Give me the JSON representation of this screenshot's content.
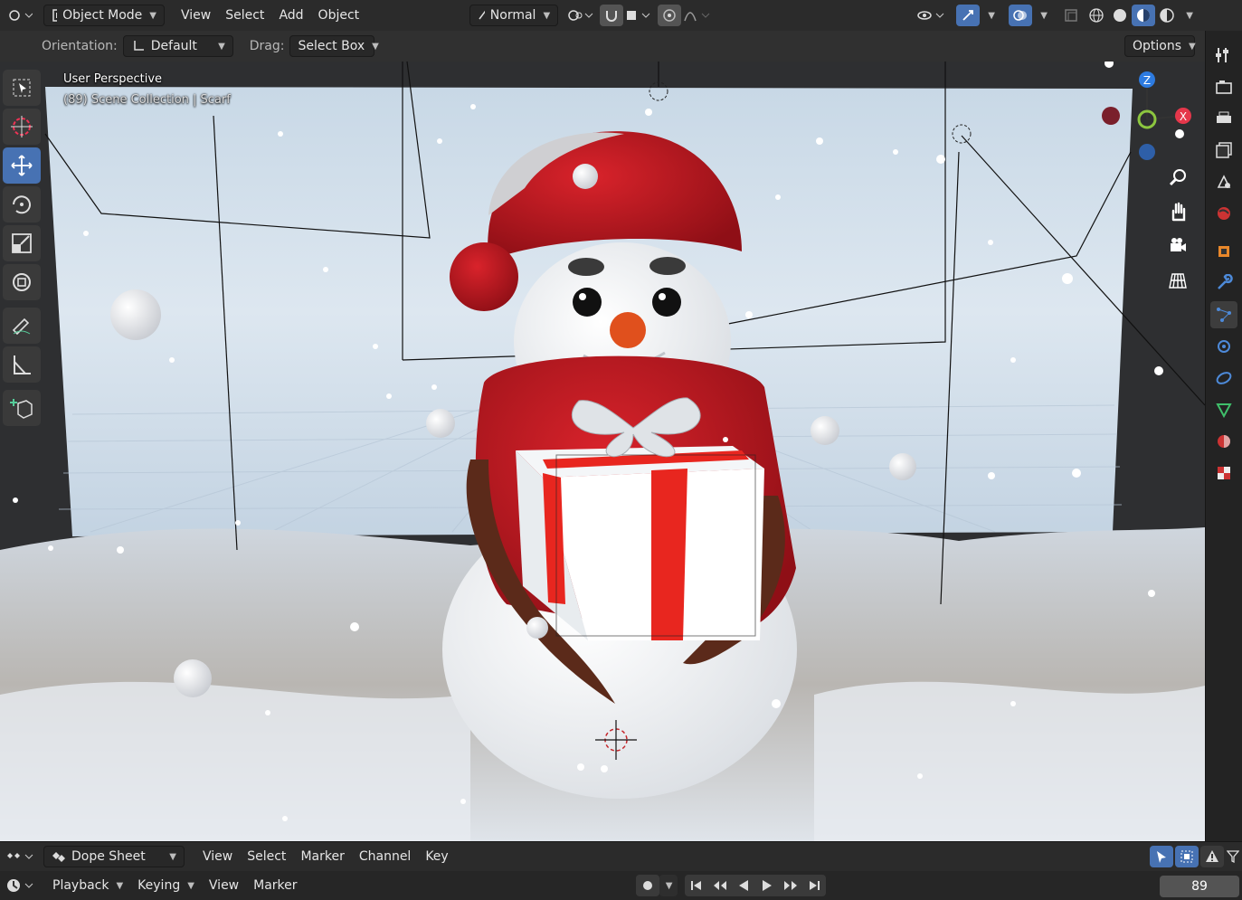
{
  "header": {
    "mode": "Object Mode",
    "menus": [
      "View",
      "Select",
      "Add",
      "Object"
    ],
    "orientation_label": "Normal",
    "options_label": "Options"
  },
  "tool_settings": {
    "orientation_label": "Orientation:",
    "orientation_value": "Default",
    "drag_label": "Drag:",
    "drag_value": "Select Box"
  },
  "viewport": {
    "title": "User Perspective",
    "subtitle": "(89) Scene Collection | Scarf",
    "gizmo_axes": [
      "Z",
      "X"
    ]
  },
  "dope_sheet": {
    "editor": "Dope Sheet",
    "menus": [
      "View",
      "Select",
      "Marker",
      "Channel",
      "Key"
    ]
  },
  "timeline": {
    "menus": [
      "Playback",
      "Keying",
      "View",
      "Marker"
    ],
    "current_frame": "89"
  },
  "colors": {
    "accent": "#4772b3",
    "x_axis": "#e5374b",
    "y_axis": "#8cc63f",
    "z_axis": "#2d7be0"
  }
}
